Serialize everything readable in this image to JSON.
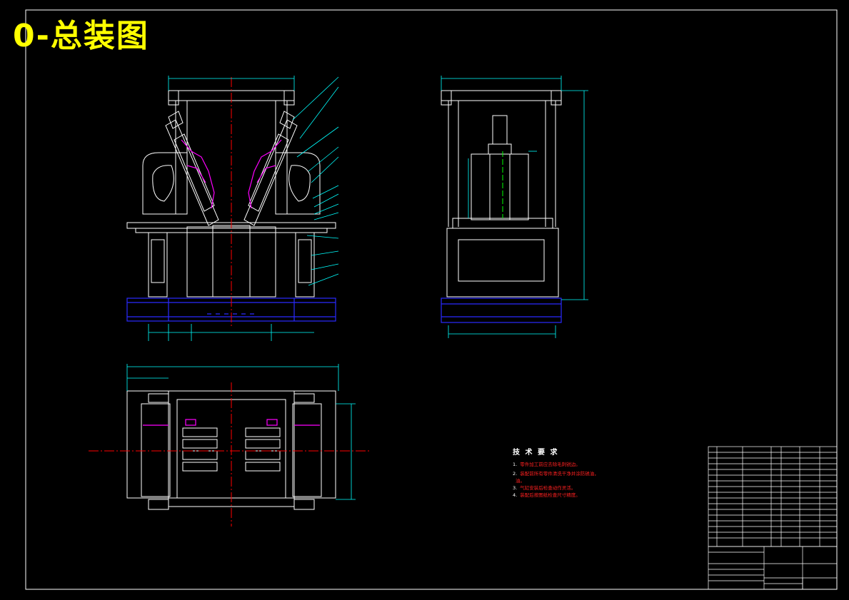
{
  "title": "0-总装图",
  "tech_requirements": {
    "heading": "技 术 要 求",
    "items": [
      {
        "num": "1.",
        "text": "零件加工前应去除毛刺锐边。"
      },
      {
        "num": "2.",
        "text": "装配前所有零件清洗干净并涂防锈油，"
      },
      {
        "num": "",
        "text": "油。"
      },
      {
        "num": "3.",
        "text": "气缸安装后检查动作灵活。"
      },
      {
        "num": "4.",
        "text": "装配后按图纸检查尺寸精度。"
      }
    ]
  },
  "colors": {
    "background": "#000000",
    "frame": "#ffffff",
    "title": "#ffff00",
    "dimension": "#00ffff",
    "centerline": "#ff0000",
    "base": "#0000ff",
    "part": "#ff00ff",
    "cylinder": "#00ff00"
  }
}
